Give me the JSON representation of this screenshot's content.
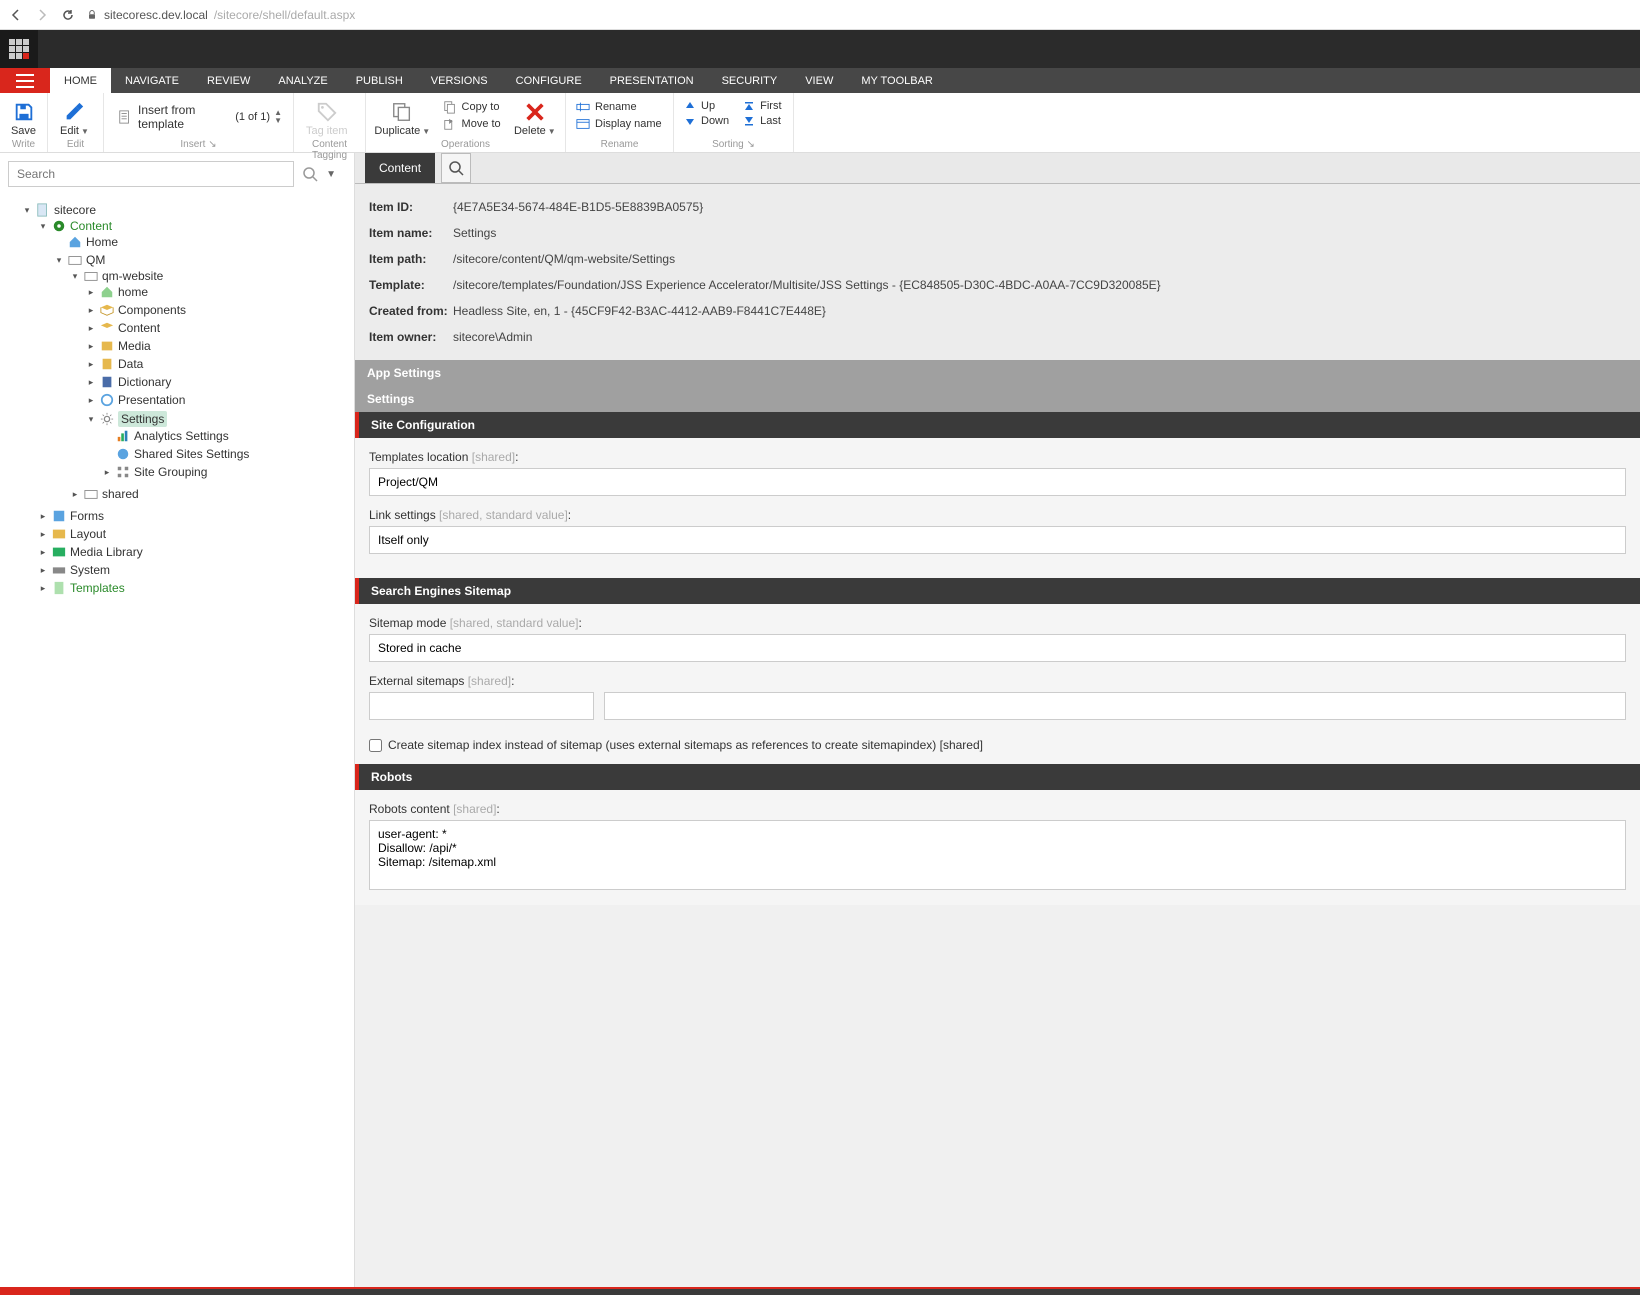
{
  "browser": {
    "url_host": "sitecoresc.dev.local",
    "url_path": "/sitecore/shell/default.aspx"
  },
  "menu": [
    "HOME",
    "NAVIGATE",
    "REVIEW",
    "ANALYZE",
    "PUBLISH",
    "VERSIONS",
    "CONFIGURE",
    "PRESENTATION",
    "SECURITY",
    "VIEW",
    "MY TOOLBAR"
  ],
  "ribbon": {
    "save": "Save",
    "write": "Write",
    "edit": "Edit",
    "editgrp": "Edit",
    "insert_template": "Insert from template",
    "insert_pager": "(1 of 1)",
    "insertgrp": "Insert",
    "tag_item": "Tag item",
    "taggrp": "Content Tagging",
    "duplicate": "Duplicate",
    "copyto": "Copy to",
    "moveto": "Move to",
    "delete": "Delete",
    "opsgrp": "Operations",
    "rename": "Rename",
    "displayname": "Display name",
    "rengrp": "Rename",
    "up": "Up",
    "down": "Down",
    "first": "First",
    "last": "Last",
    "sortgrp": "Sorting"
  },
  "search_placeholder": "Search",
  "tree": {
    "root": "sitecore",
    "content": "Content",
    "home0": "Home",
    "qm": "QM",
    "qmweb": "qm-website",
    "items": [
      "home",
      "Components",
      "Content",
      "Media",
      "Data",
      "Dictionary",
      "Presentation",
      "Settings"
    ],
    "settings_children": [
      "Analytics Settings",
      "Shared Sites Settings",
      "Site Grouping"
    ],
    "shared": "shared",
    "forms": "Forms",
    "layout": "Layout",
    "media": "Media Library",
    "system": "System",
    "templates": "Templates"
  },
  "right": {
    "tab_content": "Content",
    "meta": [
      {
        "k": "Item ID:",
        "v": "{4E7A5E34-5674-484E-B1D5-5E8839BA0575}"
      },
      {
        "k": "Item name:",
        "v": "Settings"
      },
      {
        "k": "Item path:",
        "v": "/sitecore/content/QM/qm-website/Settings"
      },
      {
        "k": "Template:",
        "v": "/sitecore/templates/Foundation/JSS Experience Accelerator/Multisite/JSS Settings - {EC848505-D30C-4BDC-A0AA-7CC9D320085E}"
      },
      {
        "k": "Created from:",
        "v": "Headless Site, en, 1 - {45CF9F42-B3AC-4412-AAB9-F8441C7E448E}"
      },
      {
        "k": "Item owner:",
        "v": "sitecore\\Admin"
      }
    ],
    "app_settings": "App Settings",
    "settings": "Settings",
    "site_config": "Site Configuration",
    "tmpl_loc_label": "Templates location",
    "shared_hint": "[shared]",
    "tmpl_loc_val": "Project/QM",
    "link_settings_label": "Link settings",
    "shared_std_hint": "[shared, standard value]",
    "link_settings_val": "Itself only",
    "sitemap_head": "Search Engines Sitemap",
    "sitemap_mode_label": "Sitemap mode",
    "sitemap_mode_val": "Stored in cache",
    "ext_sitemaps_label": "External sitemaps",
    "chk_label": "Create sitemap index instead of sitemap (uses external sitemaps as references to create sitemapindex)",
    "robots_head": "Robots",
    "robots_label": "Robots content",
    "robots_val": "user-agent: *\nDisallow: /api/*\nSitemap: /sitemap.xml"
  }
}
